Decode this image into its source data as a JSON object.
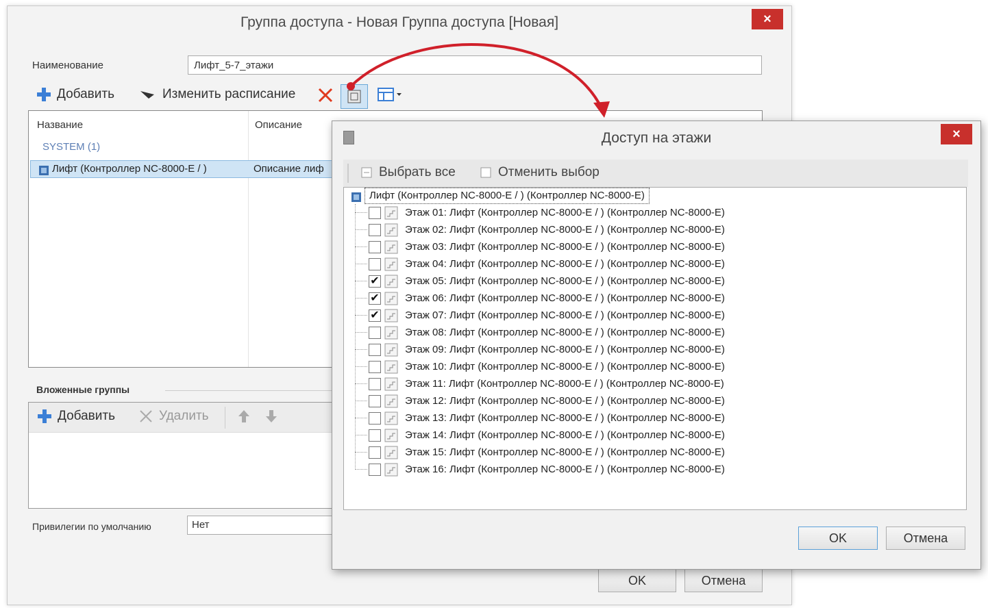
{
  "main_window": {
    "title": "Группа доступа - Новая Группа доступа [Новая]",
    "close_label": "×",
    "name_label": "Наименование",
    "name_value": "Лифт_5-7_этажи",
    "toolbar": {
      "add_label": "Добавить",
      "schedule_label": "Изменить расписание"
    },
    "grid": {
      "columns": [
        "Название",
        "Описание"
      ],
      "group_label": "SYSTEM (1)",
      "rows": [
        {
          "name": "Лифт (Контроллер NC-8000-E / )",
          "description": "Описание лиф"
        }
      ]
    },
    "nested": {
      "label": "Вложенные группы",
      "add_label": "Добавить",
      "delete_label": "Удалить"
    },
    "privileges_label": "Привилегии по умолчанию",
    "privileges_value": "Нет",
    "ok_label": "OK",
    "cancel_label": "Отмена"
  },
  "floors_dialog": {
    "title": "Доступ на этажи",
    "close_label": "×",
    "select_all_label": "Выбрать все",
    "deselect_label": "Отменить выбор",
    "root": "Лифт (Контроллер NC-8000-E / ) (Контроллер NC-8000-E)",
    "floors": [
      {
        "label": "Этаж 01: Лифт (Контроллер NC-8000-E / ) (Контроллер NC-8000-E)",
        "checked": false
      },
      {
        "label": "Этаж 02: Лифт (Контроллер NC-8000-E / ) (Контроллер NC-8000-E)",
        "checked": false
      },
      {
        "label": "Этаж 03: Лифт (Контроллер NC-8000-E / ) (Контроллер NC-8000-E)",
        "checked": false
      },
      {
        "label": "Этаж 04: Лифт (Контроллер NC-8000-E / ) (Контроллер NC-8000-E)",
        "checked": false
      },
      {
        "label": "Этаж 05: Лифт (Контроллер NC-8000-E / ) (Контроллер NC-8000-E)",
        "checked": true
      },
      {
        "label": "Этаж 06: Лифт (Контроллер NC-8000-E / ) (Контроллер NC-8000-E)",
        "checked": true
      },
      {
        "label": "Этаж 07: Лифт (Контроллер NC-8000-E / ) (Контроллер NC-8000-E)",
        "checked": true
      },
      {
        "label": "Этаж 08: Лифт (Контроллер NC-8000-E / ) (Контроллер NC-8000-E)",
        "checked": false
      },
      {
        "label": "Этаж 09: Лифт (Контроллер NC-8000-E / ) (Контроллер NC-8000-E)",
        "checked": false
      },
      {
        "label": "Этаж 10: Лифт (Контроллер NC-8000-E / ) (Контроллер NC-8000-E)",
        "checked": false
      },
      {
        "label": "Этаж 11: Лифт (Контроллер NC-8000-E / ) (Контроллер NC-8000-E)",
        "checked": false
      },
      {
        "label": "Этаж 12: Лифт (Контроллер NC-8000-E / ) (Контроллер NC-8000-E)",
        "checked": false
      },
      {
        "label": "Этаж 13: Лифт (Контроллер NC-8000-E / ) (Контроллер NC-8000-E)",
        "checked": false
      },
      {
        "label": "Этаж 14: Лифт (Контроллер NC-8000-E / ) (Контроллер NC-8000-E)",
        "checked": false
      },
      {
        "label": "Этаж 15: Лифт (Контроллер NC-8000-E / ) (Контроллер NC-8000-E)",
        "checked": false
      },
      {
        "label": "Этаж 16: Лифт (Контроллер NC-8000-E / ) (Контроллер NC-8000-E)",
        "checked": false
      }
    ],
    "ok_label": "OK",
    "cancel_label": "Отмена"
  },
  "colors": {
    "close_red": "#c8302c",
    "selection_blue": "#cfe4f5",
    "arrow_red": "#d0202a",
    "add_icon_blue": "#3b7fd6"
  },
  "icons": {
    "add": "plus-icon",
    "schedule": "clock-icon",
    "delete": "red-x-icon",
    "floors": "floors-access-icon",
    "view": "grid-view-icon",
    "floor": "floor-icon",
    "controller": "controller-icon"
  }
}
